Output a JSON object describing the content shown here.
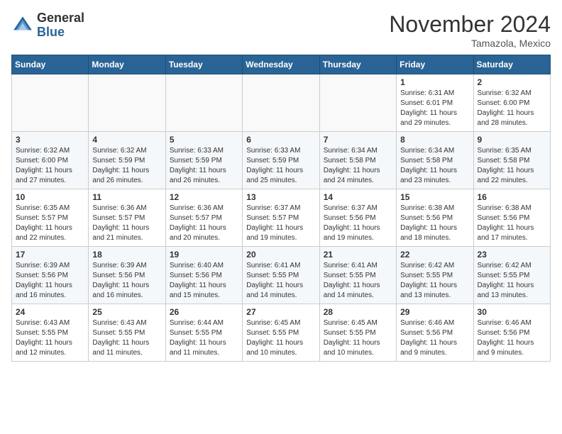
{
  "header": {
    "logo_general": "General",
    "logo_blue": "Blue",
    "month_title": "November 2024",
    "location": "Tamazola, Mexico"
  },
  "weekdays": [
    "Sunday",
    "Monday",
    "Tuesday",
    "Wednesday",
    "Thursday",
    "Friday",
    "Saturday"
  ],
  "weeks": [
    [
      {
        "day": "",
        "info": ""
      },
      {
        "day": "",
        "info": ""
      },
      {
        "day": "",
        "info": ""
      },
      {
        "day": "",
        "info": ""
      },
      {
        "day": "",
        "info": ""
      },
      {
        "day": "1",
        "info": "Sunrise: 6:31 AM\nSunset: 6:01 PM\nDaylight: 11 hours\nand 29 minutes."
      },
      {
        "day": "2",
        "info": "Sunrise: 6:32 AM\nSunset: 6:00 PM\nDaylight: 11 hours\nand 28 minutes."
      }
    ],
    [
      {
        "day": "3",
        "info": "Sunrise: 6:32 AM\nSunset: 6:00 PM\nDaylight: 11 hours\nand 27 minutes."
      },
      {
        "day": "4",
        "info": "Sunrise: 6:32 AM\nSunset: 5:59 PM\nDaylight: 11 hours\nand 26 minutes."
      },
      {
        "day": "5",
        "info": "Sunrise: 6:33 AM\nSunset: 5:59 PM\nDaylight: 11 hours\nand 26 minutes."
      },
      {
        "day": "6",
        "info": "Sunrise: 6:33 AM\nSunset: 5:59 PM\nDaylight: 11 hours\nand 25 minutes."
      },
      {
        "day": "7",
        "info": "Sunrise: 6:34 AM\nSunset: 5:58 PM\nDaylight: 11 hours\nand 24 minutes."
      },
      {
        "day": "8",
        "info": "Sunrise: 6:34 AM\nSunset: 5:58 PM\nDaylight: 11 hours\nand 23 minutes."
      },
      {
        "day": "9",
        "info": "Sunrise: 6:35 AM\nSunset: 5:58 PM\nDaylight: 11 hours\nand 22 minutes."
      }
    ],
    [
      {
        "day": "10",
        "info": "Sunrise: 6:35 AM\nSunset: 5:57 PM\nDaylight: 11 hours\nand 22 minutes."
      },
      {
        "day": "11",
        "info": "Sunrise: 6:36 AM\nSunset: 5:57 PM\nDaylight: 11 hours\nand 21 minutes."
      },
      {
        "day": "12",
        "info": "Sunrise: 6:36 AM\nSunset: 5:57 PM\nDaylight: 11 hours\nand 20 minutes."
      },
      {
        "day": "13",
        "info": "Sunrise: 6:37 AM\nSunset: 5:57 PM\nDaylight: 11 hours\nand 19 minutes."
      },
      {
        "day": "14",
        "info": "Sunrise: 6:37 AM\nSunset: 5:56 PM\nDaylight: 11 hours\nand 19 minutes."
      },
      {
        "day": "15",
        "info": "Sunrise: 6:38 AM\nSunset: 5:56 PM\nDaylight: 11 hours\nand 18 minutes."
      },
      {
        "day": "16",
        "info": "Sunrise: 6:38 AM\nSunset: 5:56 PM\nDaylight: 11 hours\nand 17 minutes."
      }
    ],
    [
      {
        "day": "17",
        "info": "Sunrise: 6:39 AM\nSunset: 5:56 PM\nDaylight: 11 hours\nand 16 minutes."
      },
      {
        "day": "18",
        "info": "Sunrise: 6:39 AM\nSunset: 5:56 PM\nDaylight: 11 hours\nand 16 minutes."
      },
      {
        "day": "19",
        "info": "Sunrise: 6:40 AM\nSunset: 5:56 PM\nDaylight: 11 hours\nand 15 minutes."
      },
      {
        "day": "20",
        "info": "Sunrise: 6:41 AM\nSunset: 5:55 PM\nDaylight: 11 hours\nand 14 minutes."
      },
      {
        "day": "21",
        "info": "Sunrise: 6:41 AM\nSunset: 5:55 PM\nDaylight: 11 hours\nand 14 minutes."
      },
      {
        "day": "22",
        "info": "Sunrise: 6:42 AM\nSunset: 5:55 PM\nDaylight: 11 hours\nand 13 minutes."
      },
      {
        "day": "23",
        "info": "Sunrise: 6:42 AM\nSunset: 5:55 PM\nDaylight: 11 hours\nand 13 minutes."
      }
    ],
    [
      {
        "day": "24",
        "info": "Sunrise: 6:43 AM\nSunset: 5:55 PM\nDaylight: 11 hours\nand 12 minutes."
      },
      {
        "day": "25",
        "info": "Sunrise: 6:43 AM\nSunset: 5:55 PM\nDaylight: 11 hours\nand 11 minutes."
      },
      {
        "day": "26",
        "info": "Sunrise: 6:44 AM\nSunset: 5:55 PM\nDaylight: 11 hours\nand 11 minutes."
      },
      {
        "day": "27",
        "info": "Sunrise: 6:45 AM\nSunset: 5:55 PM\nDaylight: 11 hours\nand 10 minutes."
      },
      {
        "day": "28",
        "info": "Sunrise: 6:45 AM\nSunset: 5:55 PM\nDaylight: 11 hours\nand 10 minutes."
      },
      {
        "day": "29",
        "info": "Sunrise: 6:46 AM\nSunset: 5:56 PM\nDaylight: 11 hours\nand 9 minutes."
      },
      {
        "day": "30",
        "info": "Sunrise: 6:46 AM\nSunset: 5:56 PM\nDaylight: 11 hours\nand 9 minutes."
      }
    ]
  ]
}
